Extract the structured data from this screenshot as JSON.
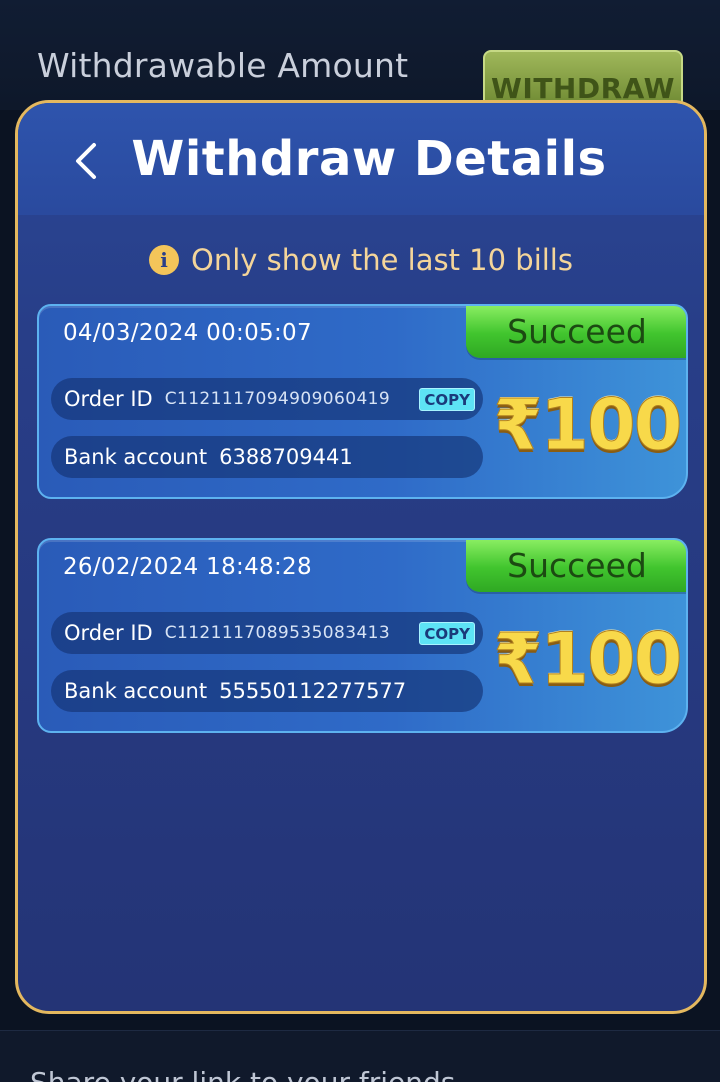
{
  "background": {
    "label": "Withdrawable Amount",
    "withdraw_button": "WITHDRAW",
    "share_text": "Share your link to your friends"
  },
  "modal": {
    "title": "Withdraw Details",
    "notice": "Only show the last 10 bills",
    "records": [
      {
        "date": "04/03/2024 00:05:07",
        "status": "Succeed",
        "order_label": "Order ID",
        "order_id": "C1121117094909060419",
        "copy_label": "COPY",
        "bank_label": "Bank account",
        "bank_account": "6388709441",
        "amount": "₹100"
      },
      {
        "date": "26/02/2024 18:48:28",
        "status": "Succeed",
        "order_label": "Order ID",
        "order_id": "C1121117089535083413",
        "copy_label": "COPY",
        "bank_label": "Bank account",
        "bank_account": "55550112277577",
        "amount": "₹100"
      }
    ]
  },
  "colors": {
    "modal_border": "#e4b85f",
    "status_green": "#41c52e",
    "amount_gold": "#f8d94a",
    "notice_text": "#f4d59a"
  },
  "icons": {
    "back": "chevron-left-icon",
    "notice": "info-icon"
  }
}
